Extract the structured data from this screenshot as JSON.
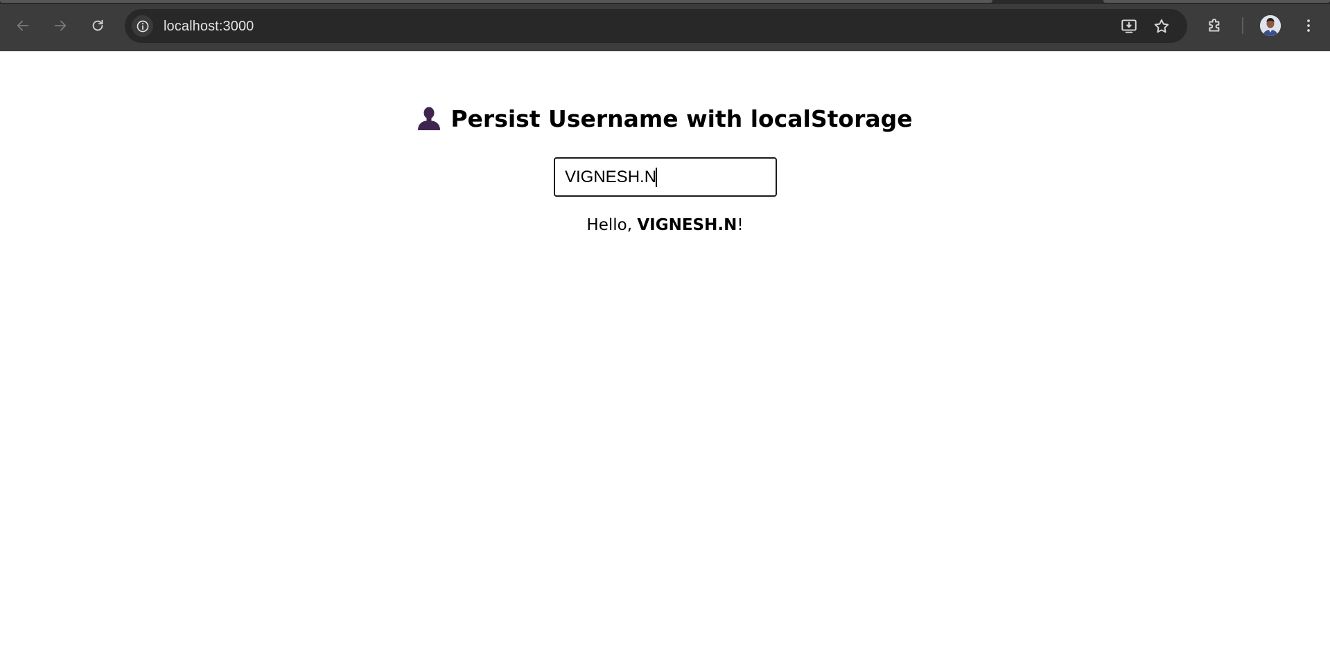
{
  "browser": {
    "url": "localhost:3000",
    "icons": {
      "back": "arrow-left-icon",
      "forward": "arrow-right-icon",
      "reload": "reload-icon",
      "site_info": "info-icon",
      "install": "install-app-icon",
      "bookmark": "star-icon",
      "extensions": "puzzle-icon",
      "menu": "kebab-menu-icon"
    },
    "colors": {
      "toolbar": "#3c3c3c",
      "omnibox": "#282828",
      "url_text": "#e3e3e3"
    }
  },
  "page": {
    "emoji": "bust-in-silhouette-icon",
    "heading": "Persist Username with localStorage",
    "input": {
      "value": "VIGNESH.N"
    },
    "greeting": {
      "prefix": "Hello, ",
      "name": "VIGNESH.N",
      "suffix": "!"
    }
  }
}
